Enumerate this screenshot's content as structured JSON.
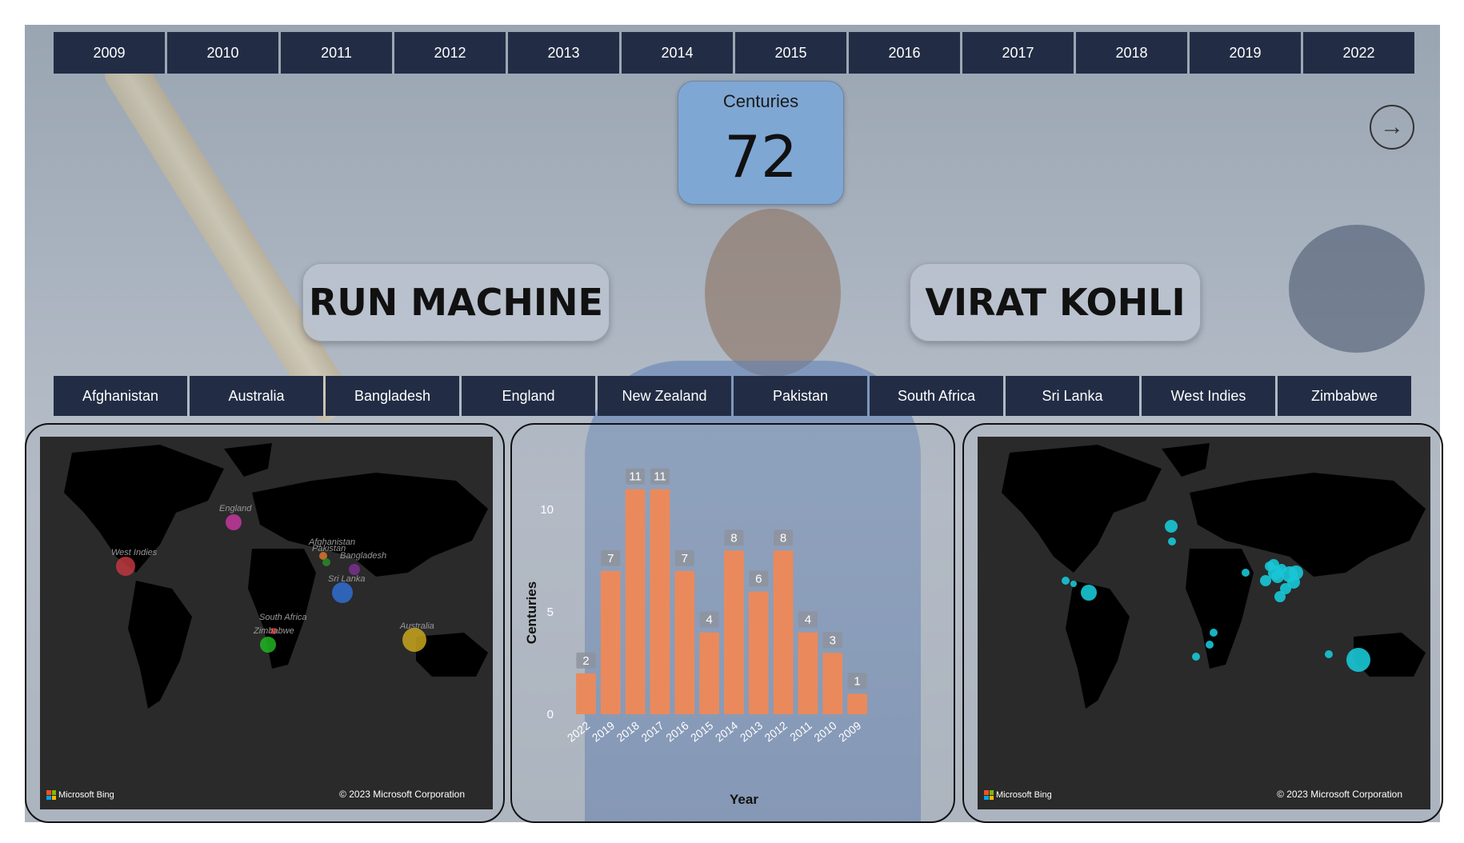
{
  "years": [
    "2009",
    "2010",
    "2011",
    "2012",
    "2013",
    "2014",
    "2015",
    "2016",
    "2017",
    "2018",
    "2019",
    "2022"
  ],
  "kpi": {
    "label": "Centuries",
    "value": "72"
  },
  "titles": {
    "left": "RUN MACHINE",
    "right": "VIRAT KOHLI"
  },
  "countries": [
    "Afghanistan",
    "Australia",
    "Bangladesh",
    "England",
    "New Zealand",
    "Pakistan",
    "South Africa",
    "Sri Lanka",
    "West Indies",
    "Zimbabwe"
  ],
  "map_left": {
    "attribution": "Microsoft Bing",
    "copyright": "© 2023 Microsoft Corporation",
    "points": [
      {
        "label": "England",
        "color": "#c2389e"
      },
      {
        "label": "West Indies",
        "color": "#c0373f"
      },
      {
        "label": "Afghanistan",
        "color": "#d8772b"
      },
      {
        "label": "Bangladesh",
        "color": "#7a2f92"
      },
      {
        "label": "Pakistan",
        "color": "#2a8a2a"
      },
      {
        "label": "Sri Lanka",
        "color": "#2f6dd0"
      },
      {
        "label": "South Africa",
        "color": "#d51f26"
      },
      {
        "label": "Zimbabwe",
        "color": "#21b521"
      },
      {
        "label": "Australia",
        "color": "#c8a51c"
      }
    ]
  },
  "map_right": {
    "attribution": "Microsoft Bing",
    "copyright": "© 2023 Microsoft Corporation",
    "marker_color": "#18c7d6"
  },
  "chart_data": {
    "type": "bar",
    "categories": [
      "2022",
      "2019",
      "2018",
      "2017",
      "2016",
      "2015",
      "2014",
      "2013",
      "2012",
      "2011",
      "2010",
      "2009"
    ],
    "values": [
      2,
      7,
      11,
      11,
      7,
      4,
      8,
      6,
      8,
      4,
      3,
      1
    ],
    "xlabel": "Year",
    "ylabel": "Centuries",
    "ylim": [
      0,
      12
    ],
    "yticks": [
      0,
      5,
      10
    ],
    "bar_color": "#ea8a5c",
    "data_labels": true
  },
  "nav": {
    "next_icon": "arrow-right-icon"
  }
}
